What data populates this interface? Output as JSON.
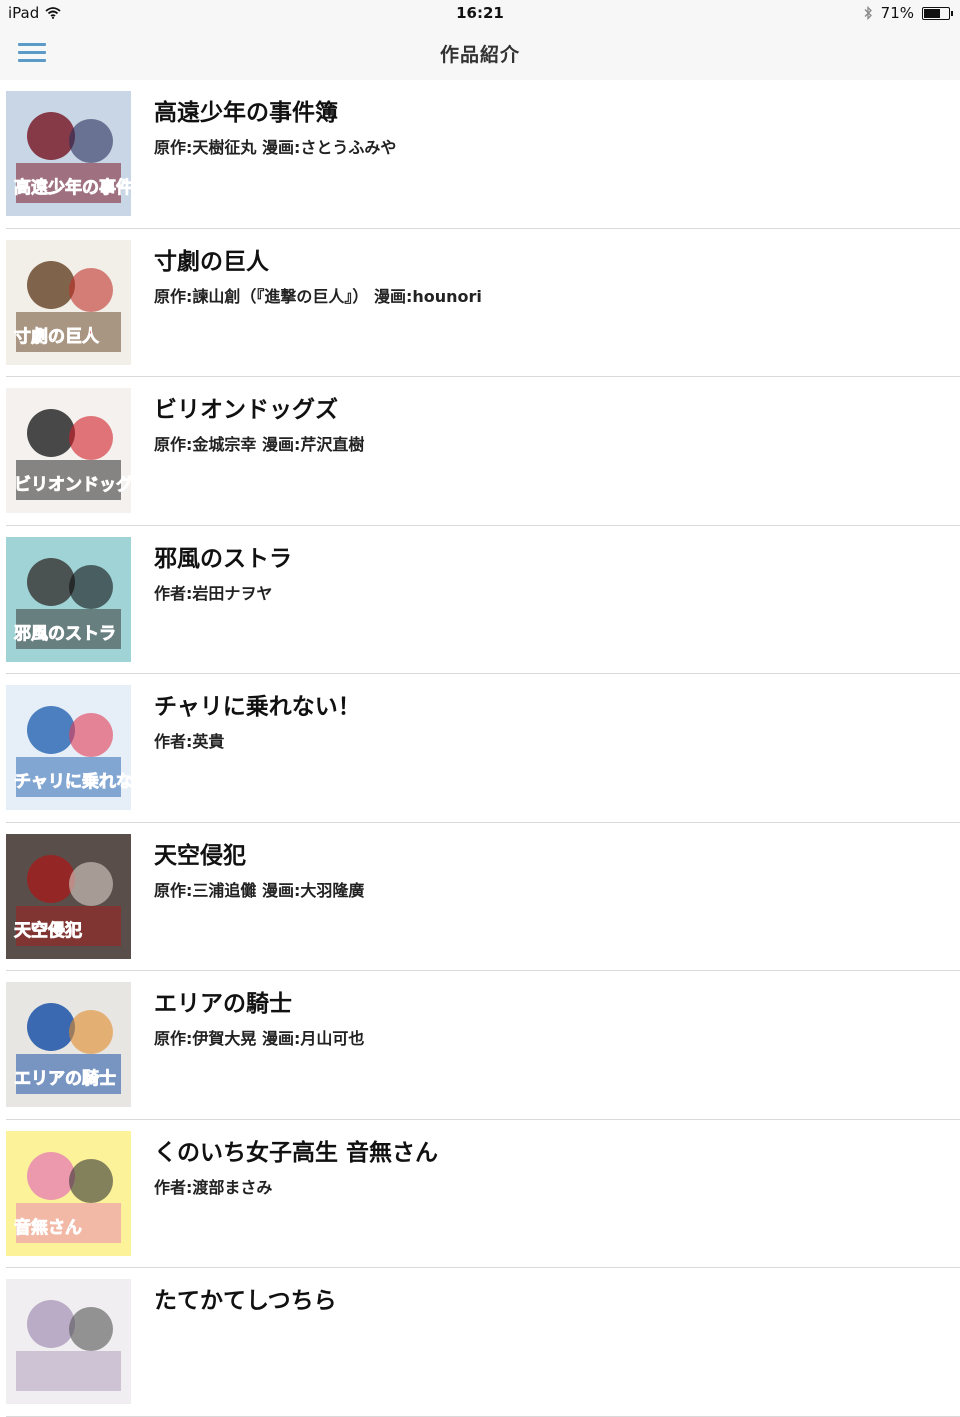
{
  "status_bar": {
    "device": "iPad",
    "time": "16:21",
    "battery_text": "71%",
    "battery_level": 0.71
  },
  "nav": {
    "title": "作品紹介"
  },
  "works": [
    {
      "title": "高遠少年の事件簿",
      "author": "原作:天樹征丸 漫画:さとうふみや",
      "cover_caption": "高遠少年の事件簿",
      "colors": [
        "#c9d6e6",
        "#7a1e2c",
        "#2a2f5a"
      ]
    },
    {
      "title": "寸劇の巨人",
      "author": "原作:諫山創（『進撃の巨人』） 漫画:hounori",
      "cover_caption": "寸劇の巨人",
      "colors": [
        "#f2efe8",
        "#6b4a2e",
        "#c0302b"
      ]
    },
    {
      "title": "ビリオンドッグズ",
      "author": "原作:金城宗幸 漫画:芹沢直樹",
      "cover_caption": "ビリオンドッグズ",
      "colors": [
        "#f4f1ee",
        "#2a2a2a",
        "#d0202a"
      ]
    },
    {
      "title": "邪風のストラ",
      "author": "作者:岩田ナヲヤ",
      "cover_caption": "邪風のストラ",
      "colors": [
        "#9fd3d6",
        "#3b3b3b",
        "#111111"
      ]
    },
    {
      "title": "チャリに乗れない！",
      "author": "作者:英貴",
      "cover_caption": "チャリに乗れない!",
      "colors": [
        "#e6eef7",
        "#2f6bb5",
        "#e23a55"
      ]
    },
    {
      "title": "天空侵犯",
      "author": "原作:三浦追儺 漫画:大羽隆廣",
      "cover_caption": "天空侵犯",
      "colors": [
        "#5a4e4a",
        "#a02020",
        "#d8d0c8"
      ]
    },
    {
      "title": "エリアの騎士",
      "author": "原作:伊賀大晃 漫画:月山可也",
      "cover_caption": "エリアの騎士",
      "colors": [
        "#e8e6e2",
        "#1c52a8",
        "#e08a2a"
      ]
    },
    {
      "title": "くのいち女子高生 音無さん",
      "author": "作者:渡部まさみ",
      "cover_caption": "音無さん",
      "colors": [
        "#fbf29a",
        "#e98ab0",
        "#333333"
      ]
    },
    {
      "title": "たてかてしつちら",
      "author": "",
      "cover_caption": "",
      "colors": [
        "#f0eef0",
        "#b0a0c0",
        "#555555"
      ]
    }
  ]
}
